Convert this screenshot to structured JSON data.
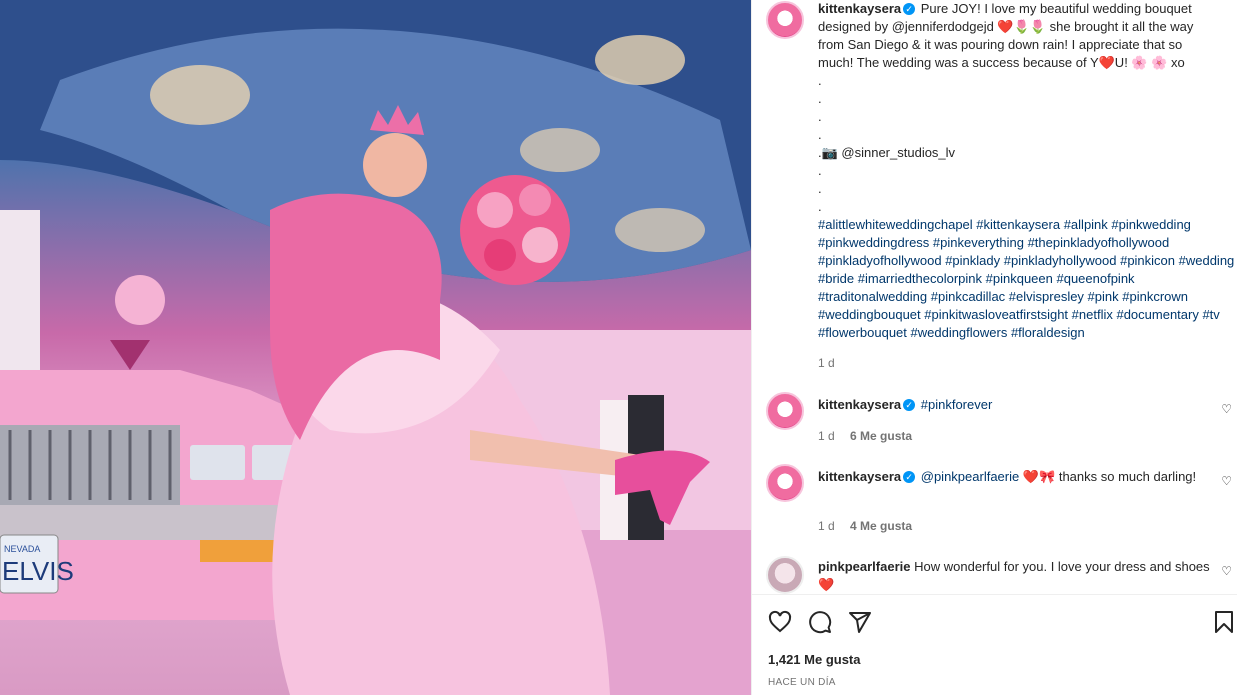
{
  "post": {
    "author": "kittenkaysera",
    "caption_lines": [
      "Pure JOY! I love my beautiful wedding bouquet",
      "designed by @jenniferdodgejd ❤️🌷🌷 she brought it all the way",
      "from San Diego & it was pouring down rain! I appreciate that so",
      "much! The wedding was a success because of Y❤️U! 🌸 🌸 xo",
      ".",
      ".",
      ".",
      ".",
      ".📷 @sinner_studios_lv",
      ".",
      ".",
      "."
    ],
    "hashtags": "#alittlewhiteweddingchapel #kittenkaysera #allpink #pinkwedding #pinkweddingdress #pinkeverything #thepinkladyofhollywood #pinkladyofhollywood #pinklady #pinkladyhollywood #pinkicon #wedding #bride #imarriedthecolorpink #pinkqueen #queenofpink #traditonalwedding #pinkcadillac #elvispresley #pink #pinkcrown #weddingbouquet #pinkitwasloveatfirstsight #netflix #documentary #tv #flowerbouquet #weddingflowers #floraldesign",
    "time": "1 d"
  },
  "comments": [
    {
      "user": "kittenkaysera",
      "verified": true,
      "text": "#pinkforever",
      "time": "1 d",
      "likes": "6 Me gusta"
    },
    {
      "user": "kittenkaysera",
      "verified": true,
      "mention": "@pinkpearlfaerie",
      "text": "❤️🎀 thanks so much darling!",
      "time": "1 d",
      "likes": "4 Me gusta"
    },
    {
      "user": "pinkpearlfaerie",
      "verified": false,
      "text": "How wonderful for you. I love your dress and shoes ❤️"
    }
  ],
  "footer": {
    "likes": "1,421 Me gusta",
    "time_ago": "HACE UN DÍA"
  },
  "photo": {
    "plate_text": "ELVIS",
    "plate_state": "NEVADA"
  },
  "colors": {
    "link": "#00376b",
    "verified": "#0095f6",
    "text": "#262626",
    "muted": "#737373"
  }
}
